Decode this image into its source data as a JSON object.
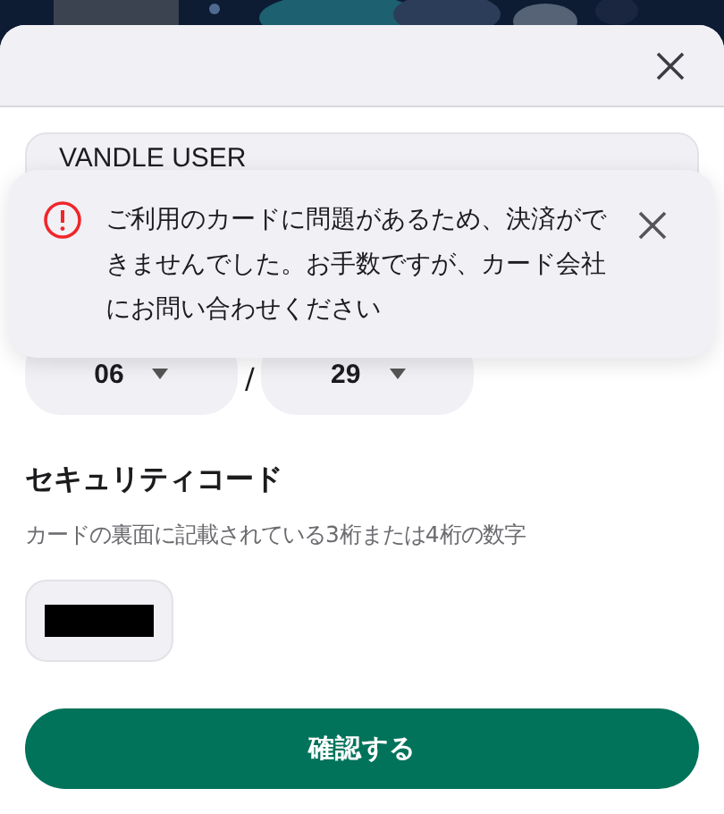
{
  "name_field": {
    "value": "VANDLE USER"
  },
  "toast": {
    "message": "ご利用のカードに問題があるため、決済ができませんでした。お手数ですが、カード会社にお問い合わせください"
  },
  "expiry": {
    "month": "06",
    "separator": "/",
    "year": "29"
  },
  "security": {
    "title": "セキュリティコード",
    "hint": "カードの裏面に記載されている3桁または4桁の数字"
  },
  "button": {
    "label": "確認する"
  }
}
